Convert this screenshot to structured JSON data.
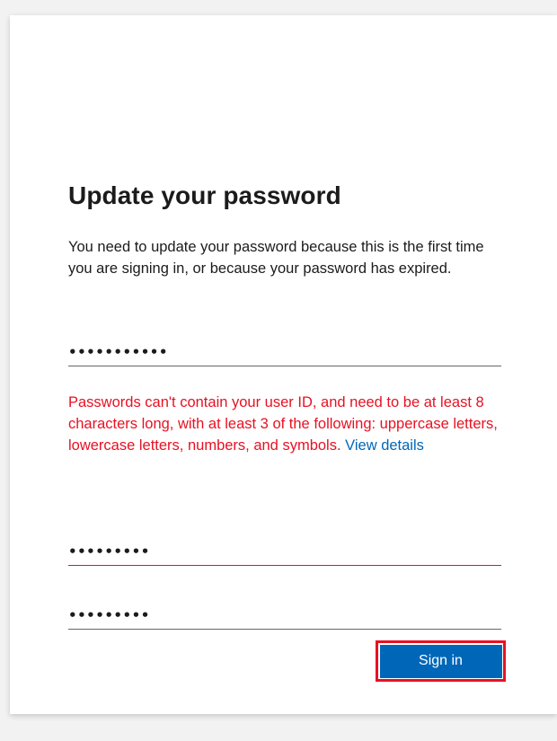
{
  "dialog": {
    "title": "Update your password",
    "description": "You need to update your password because this is the first time you are signing in, or because your password has expired."
  },
  "fields": {
    "current_password": {
      "value": "•••••••••••"
    },
    "new_password": {
      "value": "•••••••••"
    },
    "confirm_password": {
      "value": "•••••••••"
    }
  },
  "error": {
    "message": "Passwords can't contain your user ID, and need to be at least 8 characters long, with at least 3 of the following: uppercase letters, lowercase letters, numbers, and symbols.",
    "link_label": "View details"
  },
  "actions": {
    "sign_in_label": "Sign in"
  },
  "colors": {
    "accent": "#0067b8",
    "error": "#e81123",
    "highlight_border": "#e81123"
  }
}
